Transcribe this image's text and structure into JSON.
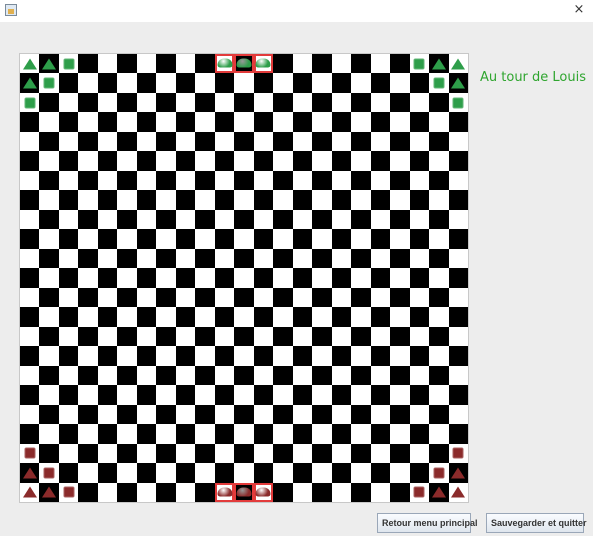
{
  "window": {
    "close_glyph": "×",
    "app_icon": "java-app-icon"
  },
  "status": {
    "text": "Au tour de Louis"
  },
  "buttons": {
    "main_menu": "Retour menu principal",
    "save_quit": "Sauvegarder et quitter"
  },
  "colors": {
    "green_piece": "#2e9e4a",
    "red_piece": "#8b2b2b",
    "target_outline": "#e23b3b",
    "status_text": "#2fa52f"
  },
  "board": {
    "size": 23,
    "pieces": [
      {
        "row": 0,
        "col": 0,
        "shape": "triangle",
        "player": "green"
      },
      {
        "row": 0,
        "col": 1,
        "shape": "triangle",
        "player": "green"
      },
      {
        "row": 0,
        "col": 2,
        "shape": "square",
        "player": "green"
      },
      {
        "row": 1,
        "col": 0,
        "shape": "triangle",
        "player": "green"
      },
      {
        "row": 1,
        "col": 1,
        "shape": "square",
        "player": "green"
      },
      {
        "row": 2,
        "col": 0,
        "shape": "square",
        "player": "green"
      },
      {
        "row": 0,
        "col": 20,
        "shape": "square",
        "player": "green"
      },
      {
        "row": 0,
        "col": 21,
        "shape": "triangle",
        "player": "green"
      },
      {
        "row": 0,
        "col": 22,
        "shape": "triangle",
        "player": "green"
      },
      {
        "row": 1,
        "col": 21,
        "shape": "square",
        "player": "green"
      },
      {
        "row": 1,
        "col": 22,
        "shape": "triangle",
        "player": "green"
      },
      {
        "row": 2,
        "col": 22,
        "shape": "square",
        "player": "green"
      },
      {
        "row": 0,
        "col": 10,
        "shape": "dome",
        "player": "green",
        "target": true
      },
      {
        "row": 0,
        "col": 11,
        "shape": "dome",
        "player": "green",
        "target": true
      },
      {
        "row": 0,
        "col": 12,
        "shape": "dome",
        "player": "green",
        "target": true
      },
      {
        "row": 20,
        "col": 0,
        "shape": "square",
        "player": "red"
      },
      {
        "row": 21,
        "col": 0,
        "shape": "triangle",
        "player": "red"
      },
      {
        "row": 21,
        "col": 1,
        "shape": "square",
        "player": "red"
      },
      {
        "row": 22,
        "col": 0,
        "shape": "triangle",
        "player": "red"
      },
      {
        "row": 22,
        "col": 1,
        "shape": "triangle",
        "player": "red"
      },
      {
        "row": 22,
        "col": 2,
        "shape": "square",
        "player": "red"
      },
      {
        "row": 20,
        "col": 22,
        "shape": "square",
        "player": "red"
      },
      {
        "row": 21,
        "col": 21,
        "shape": "square",
        "player": "red"
      },
      {
        "row": 21,
        "col": 22,
        "shape": "triangle",
        "player": "red"
      },
      {
        "row": 22,
        "col": 20,
        "shape": "square",
        "player": "red"
      },
      {
        "row": 22,
        "col": 21,
        "shape": "triangle",
        "player": "red"
      },
      {
        "row": 22,
        "col": 22,
        "shape": "triangle",
        "player": "red"
      },
      {
        "row": 22,
        "col": 10,
        "shape": "dome",
        "player": "red",
        "target": true
      },
      {
        "row": 22,
        "col": 11,
        "shape": "dome",
        "player": "red",
        "target": true
      },
      {
        "row": 22,
        "col": 12,
        "shape": "dome",
        "player": "red",
        "target": true
      }
    ]
  }
}
